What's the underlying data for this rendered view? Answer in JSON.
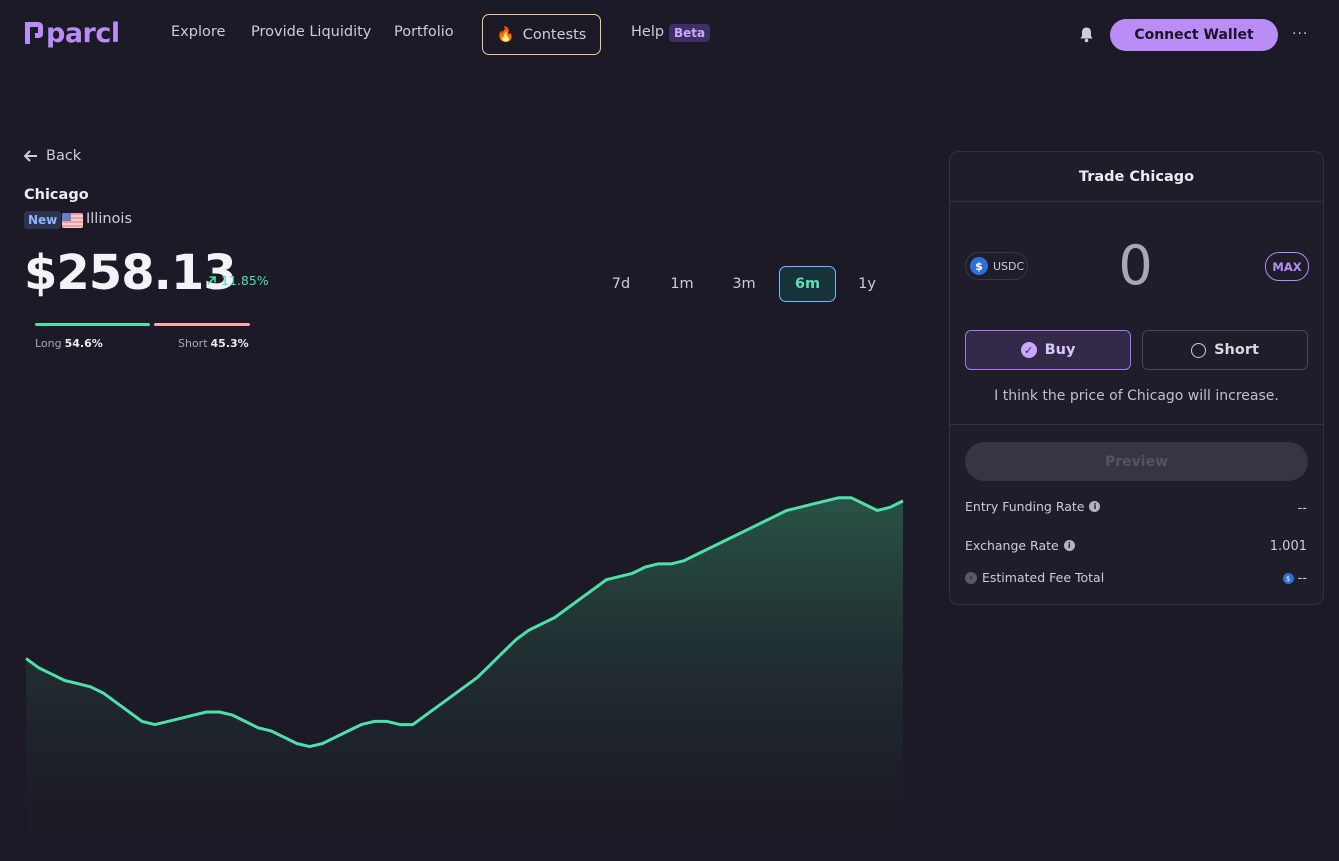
{
  "brand": {
    "name": "parcl",
    "accent": "#b98cf7"
  },
  "nav": {
    "links": [
      "Explore",
      "Provide Liquidity",
      "Portfolio"
    ],
    "contests": {
      "emoji": "🔥",
      "label": "Contests"
    },
    "help": "Help",
    "beta": "Beta",
    "connect_wallet": "Connect Wallet",
    "more": "···"
  },
  "market": {
    "back": "Back",
    "name": "Chicago",
    "badge": "New",
    "state": "Illinois",
    "price": "$258.13",
    "change": "11.85%",
    "long_label": "Long",
    "long_pct": "54.6%",
    "long_share": 0.546,
    "short_label": "Short",
    "short_pct": "45.3%",
    "short_share": 0.453,
    "long_color": "#4fe0aa",
    "short_color": "#f9a9a9"
  },
  "ranges": {
    "options": [
      "7d",
      "1m",
      "3m",
      "6m",
      "1y"
    ],
    "selected": "6m"
  },
  "chart_data": {
    "type": "area",
    "title": "",
    "xlabel": "",
    "ylabel": "",
    "grid": false,
    "line_color": "#4fe0aa",
    "series": [
      {
        "values": [
          0.37,
          0.34,
          0.32,
          0.3,
          0.29,
          0.28,
          0.26,
          0.23,
          0.2,
          0.17,
          0.16,
          0.17,
          0.18,
          0.19,
          0.2,
          0.2,
          0.19,
          0.17,
          0.15,
          0.14,
          0.12,
          0.1,
          0.09,
          0.1,
          0.12,
          0.14,
          0.16,
          0.17,
          0.17,
          0.16,
          0.16,
          0.19,
          0.22,
          0.25,
          0.28,
          0.31,
          0.35,
          0.39,
          0.43,
          0.46,
          0.48,
          0.5,
          0.53,
          0.56,
          0.59,
          0.62,
          0.63,
          0.64,
          0.66,
          0.67,
          0.67,
          0.68,
          0.7,
          0.72,
          0.74,
          0.76,
          0.78,
          0.8,
          0.82,
          0.84,
          0.85,
          0.86,
          0.87,
          0.88,
          0.88,
          0.86,
          0.84,
          0.85,
          0.87
        ]
      }
    ]
  },
  "trade": {
    "title": "Trade Chicago",
    "currency": "USDC",
    "amount": "0",
    "max": "MAX",
    "buy": "Buy",
    "short": "Short",
    "hint": "I think the price of Chicago will increase.",
    "preview": "Preview",
    "entry_funding_label": "Entry Funding Rate",
    "entry_funding_value": "--",
    "exchange_rate_label": "Exchange Rate",
    "exchange_rate_value": "1.001",
    "fee_label": "Estimated Fee Total",
    "fee_value": "--"
  }
}
